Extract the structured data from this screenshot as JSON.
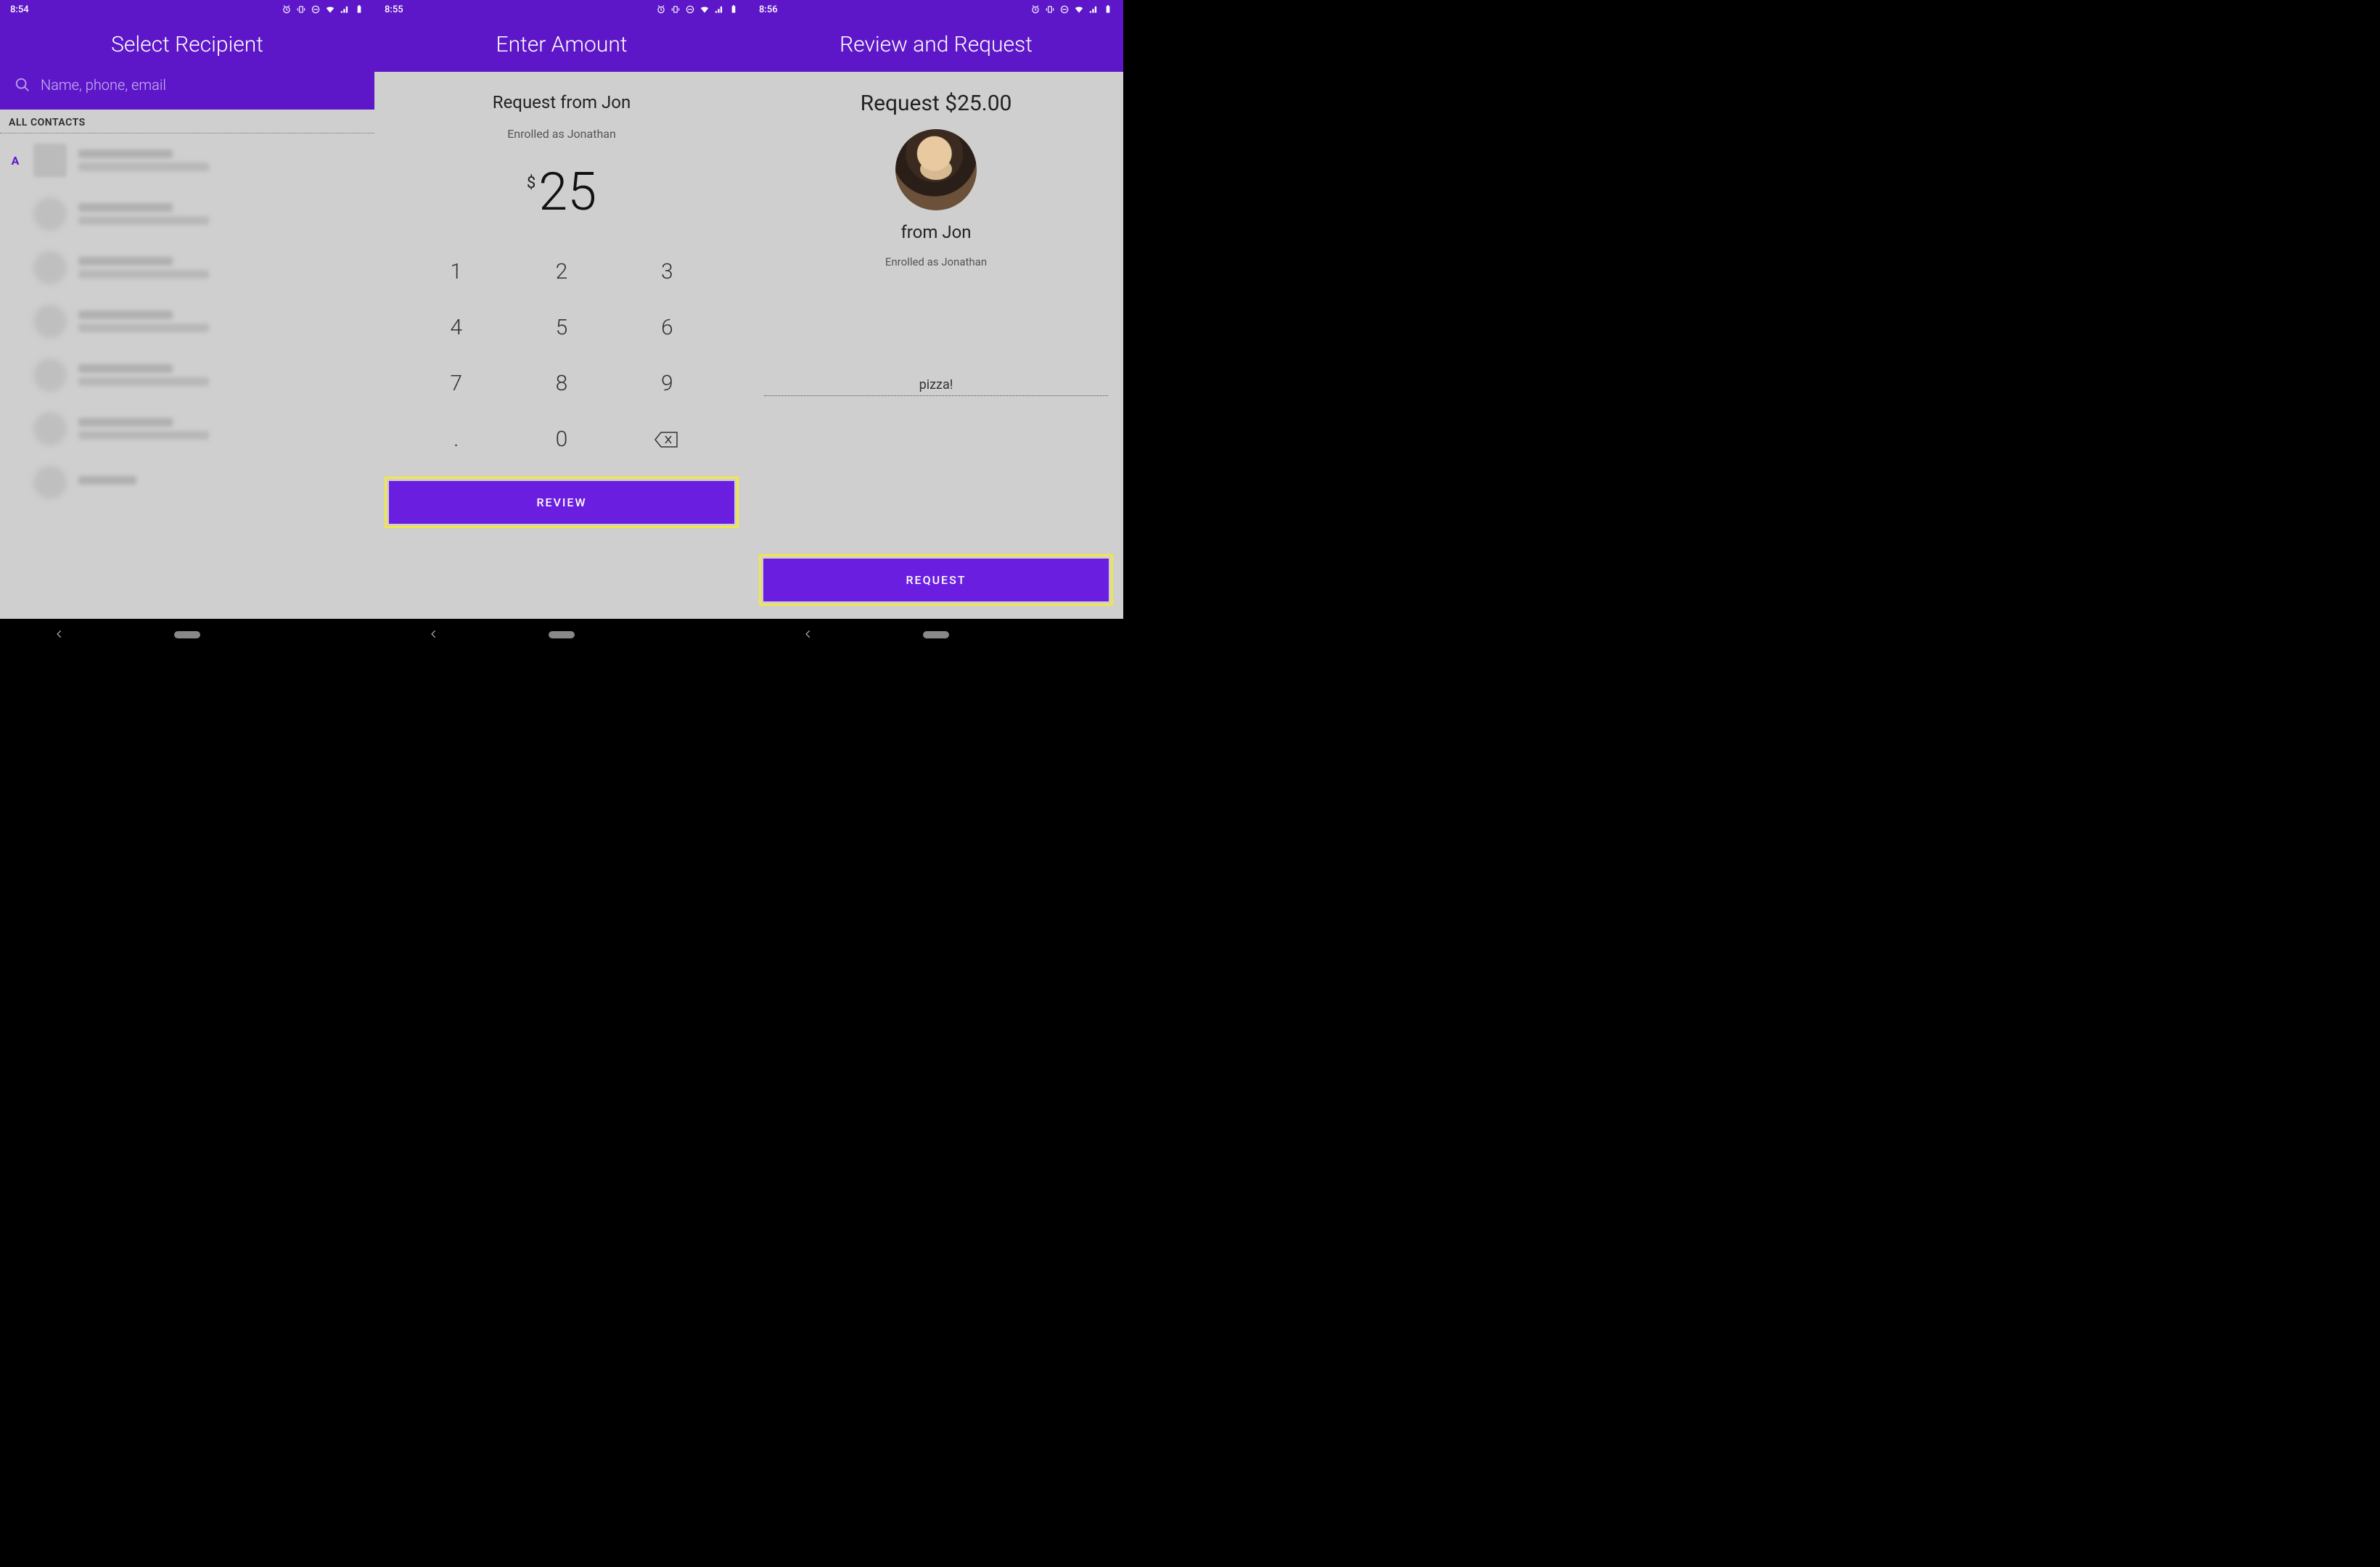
{
  "screen1": {
    "time": "8:54",
    "title": "Select Recipient",
    "search_placeholder": "Name, phone, email",
    "section_label": "ALL CONTACTS",
    "index_letter": "A"
  },
  "screen2": {
    "time": "8:55",
    "title": "Enter Amount",
    "request_from": "Request from Jon",
    "enrolled_as": "Enrolled as Jonathan",
    "currency": "$",
    "amount": "25",
    "keys": {
      "k1": "1",
      "k2": "2",
      "k3": "3",
      "k4": "4",
      "k5": "5",
      "k6": "6",
      "k7": "7",
      "k8": "8",
      "k9": "9",
      "kdot": ".",
      "k0": "0"
    },
    "cta": "REVIEW"
  },
  "screen3": {
    "time": "8:56",
    "title": "Review and Request",
    "request_amount": "Request $25.00",
    "from": "from Jon",
    "enrolled_as": "Enrolled as Jonathan",
    "memo": "pizza!",
    "cta": "REQUEST"
  }
}
